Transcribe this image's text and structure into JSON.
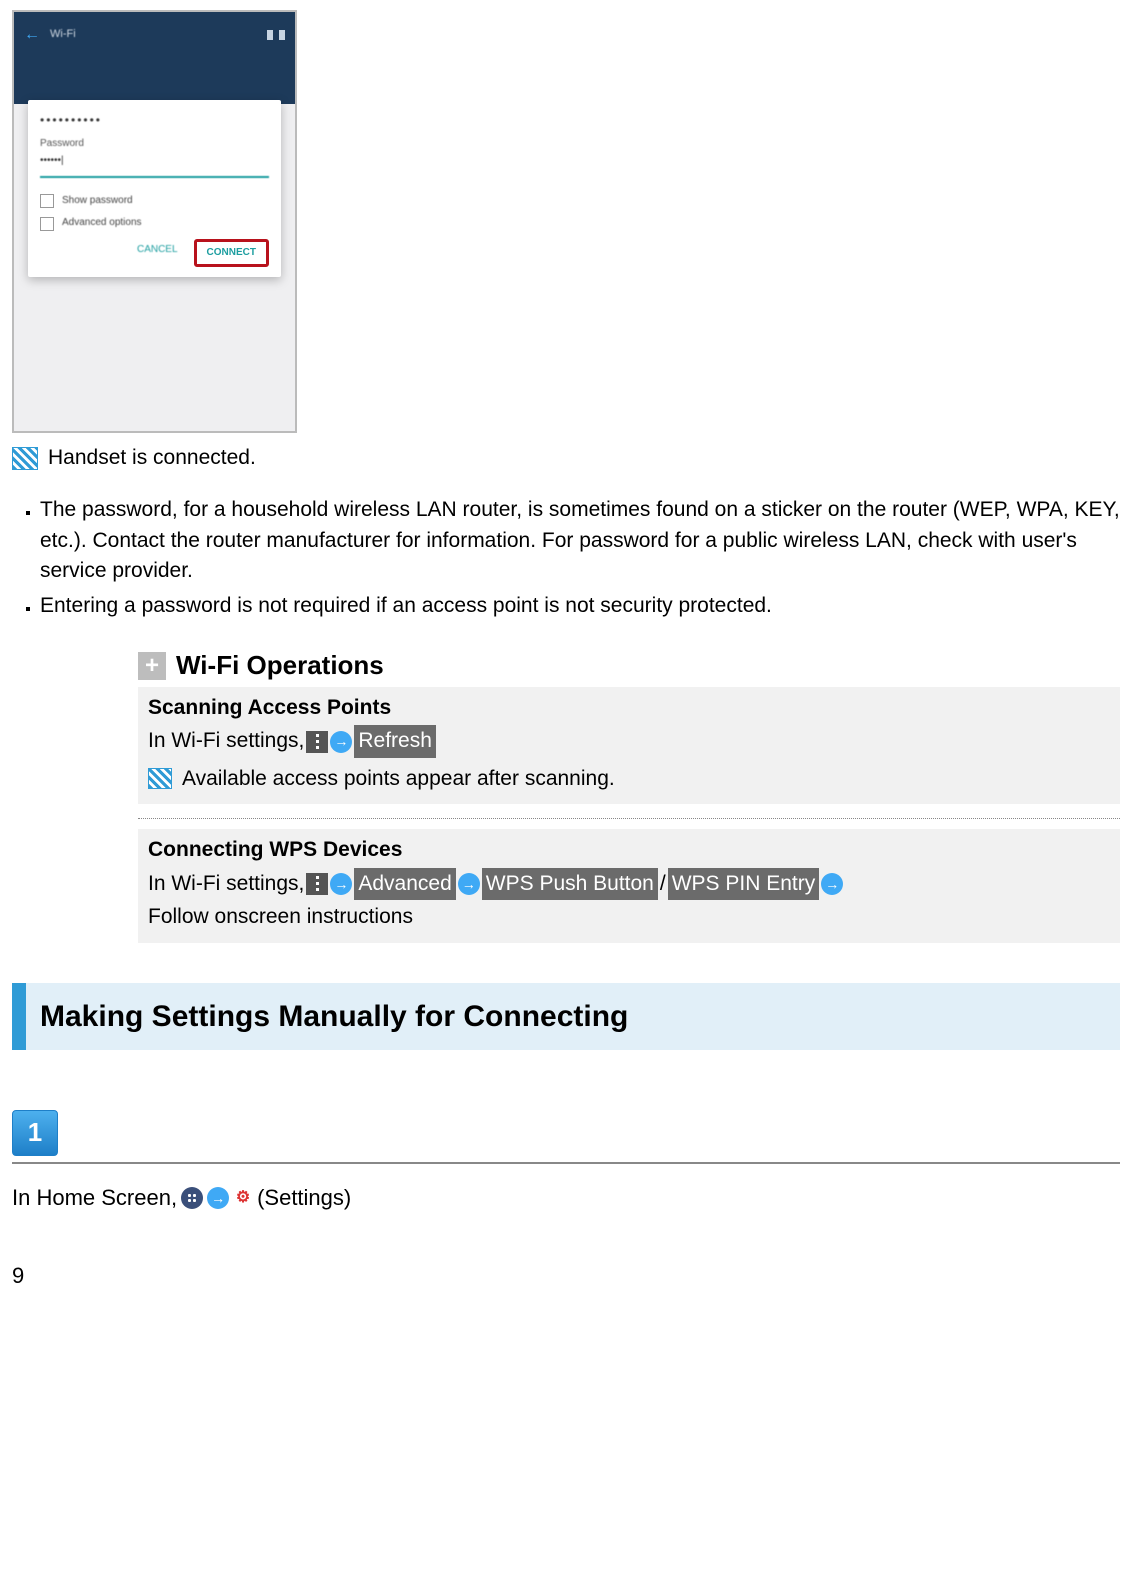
{
  "screenshot": {
    "topbar": {
      "back_label": "Wi-Fi"
    },
    "dialog": {
      "dots": "••••••••••",
      "field_label": "Password",
      "input_value": "••••••|",
      "show_password": "Show password",
      "advanced_options": "Advanced options",
      "cancel": "CANCEL",
      "connect": "CONNECT"
    }
  },
  "connected_text": "Handset is connected.",
  "notes": [
    "The password, for a household wireless LAN router, is sometimes found on a sticker on the router (WEP, WPA, KEY, etc.). Contact the router manufacturer for information. For password for a public wireless LAN, check with user's service provider.",
    "Entering a password is not required if an access point is not security protected."
  ],
  "ops": {
    "title": "Wi-Fi Operations",
    "scan": {
      "heading": "Scanning Access Points",
      "prefix": "In Wi-Fi settings, ",
      "refresh": "Refresh",
      "result": "Available access points appear after scanning."
    },
    "wps": {
      "heading": "Connecting WPS Devices",
      "prefix": "In Wi-Fi settings, ",
      "advanced": "Advanced",
      "push": "WPS Push Button",
      "slash": "/",
      "pin": "WPS PIN Entry",
      "follow": "Follow onscreen instructions"
    }
  },
  "section_heading": "Making Settings Manually for Connecting",
  "step1": {
    "num": "1",
    "prefix": "In Home Screen, ",
    "settings": "(Settings)"
  },
  "page_number": "9"
}
